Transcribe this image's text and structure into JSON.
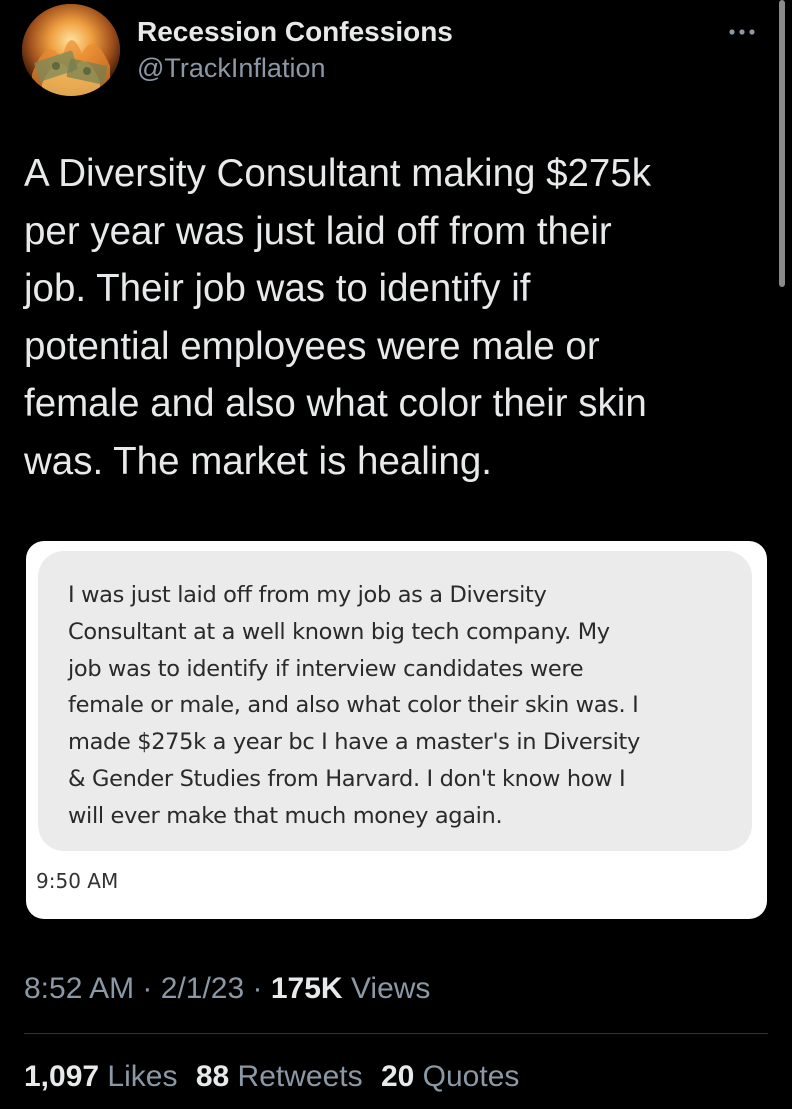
{
  "author": {
    "display_name": "Recession Confessions",
    "handle": "@TrackInflation",
    "avatar_icon": "burning-money-avatar"
  },
  "more_icon": "more-options-icon",
  "tweet": {
    "text": "A Diversity Consultant making $275k\nper year was just laid off from their\njob. Their job was to identify if\npotential employees were male or\nfemale and also what color their skin\nwas. The market is healing."
  },
  "quoted_message": {
    "text": "I was just laid off from my job as a Diversity\nConsultant at a well known big tech company. My\njob was to identify if interview candidates were\nfemale or male, and also what color their skin was. I\nmade $275k a year bc I have a master's in Diversity\n& Gender Studies from Harvard.  I don't know how I\nwill ever make that much money again.",
    "time": "9:50 AM"
  },
  "meta": {
    "time": "8:52 AM",
    "separator": "·",
    "date": "2/1/23",
    "views_count": "175K",
    "views_label": "Views"
  },
  "stats": {
    "likes_count": "1,097",
    "likes_label": "Likes",
    "retweets_count": "88",
    "retweets_label": "Retweets",
    "quotes_count": "20",
    "quotes_label": "Quotes"
  },
  "colors": {
    "background": "#000000",
    "primary_text": "#e7e9ea",
    "secondary_text": "#8b98a5",
    "card": "#ffffff",
    "bubble": "#ebebeb"
  }
}
